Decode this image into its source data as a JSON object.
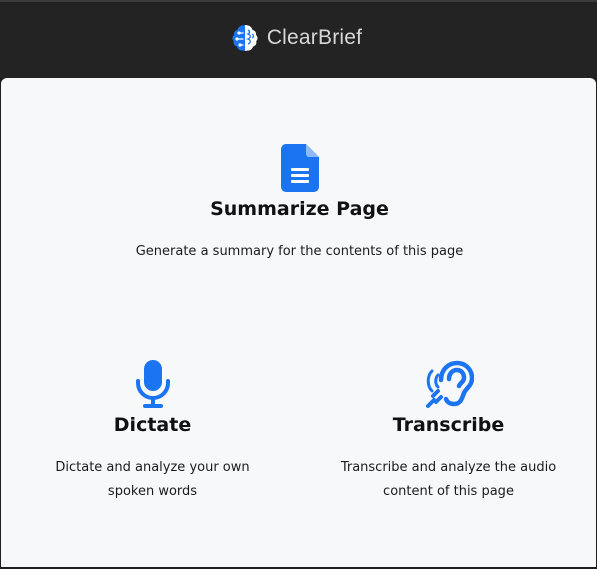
{
  "app": {
    "name": "ClearBrief",
    "logo_icon": "brain-icon",
    "accent_color": "#1b74f0"
  },
  "actions": {
    "summarize": {
      "icon": "document-icon",
      "title": "Summarize Page",
      "description": "Generate a summary for the contents of this page"
    },
    "dictate": {
      "icon": "microphone-icon",
      "title": "Dictate",
      "description": "Dictate and analyze your own spoken words"
    },
    "transcribe": {
      "icon": "ear-listen-icon",
      "title": "Transcribe",
      "description": "Transcribe and analyze the audio content of this page"
    }
  }
}
